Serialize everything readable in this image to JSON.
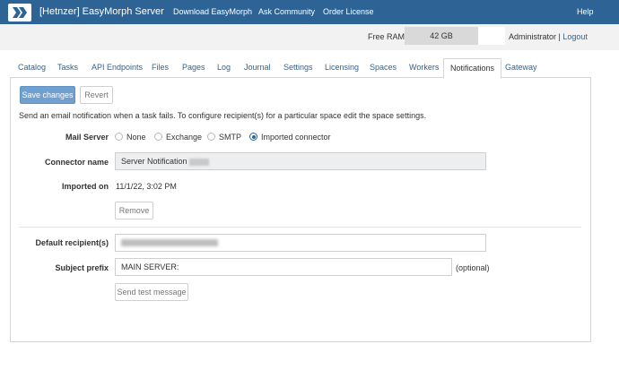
{
  "header": {
    "brand": "[Hetnzer] EasyMorph Server",
    "nav": [
      "Download EasyMorph",
      "Ask Community",
      "Order License"
    ],
    "help": "Help",
    "logo_icon": "easymorph-chevrons-icon",
    "bar_color": "#2d6495"
  },
  "status": {
    "ram_label": "Free RAM",
    "ram_value": "42 GB",
    "user": "Administrator",
    "separator": "|",
    "logout": "Logout"
  },
  "tabs": [
    {
      "label": "Catalog"
    },
    {
      "label": "Tasks"
    },
    {
      "label": "API Endpoints"
    },
    {
      "label": "Files"
    },
    {
      "label": "Pages"
    },
    {
      "label": "Log"
    },
    {
      "label": "Journal"
    },
    {
      "label": "Settings"
    },
    {
      "label": "Licensing"
    },
    {
      "label": "Spaces"
    },
    {
      "label": "Workers"
    },
    {
      "label": "Notifications",
      "active": true
    },
    {
      "label": "Gateway"
    }
  ],
  "toolbar": {
    "save_label": "Save changes",
    "revert_label": "Revert"
  },
  "form": {
    "info": "Send an email notification when a task fails. To configure recipient(s) for a particular space edit the space settings.",
    "mail_server": {
      "label": "Mail Server",
      "options": [
        "None",
        "Exchange",
        "SMTP",
        "Imported connector"
      ],
      "selected": "Imported connector"
    },
    "connector": {
      "label": "Connector name",
      "value": "Server Notification"
    },
    "imported": {
      "label": "Imported on",
      "value": "11/1/22, 3:02 PM"
    },
    "remove_label": "Remove",
    "recipient": {
      "label": "Default recipient(s)",
      "value": ""
    },
    "subject": {
      "label": "Subject prefix",
      "value": "MAIN SERVER:",
      "hint": "(optional)"
    },
    "test_label": "Send test message"
  }
}
